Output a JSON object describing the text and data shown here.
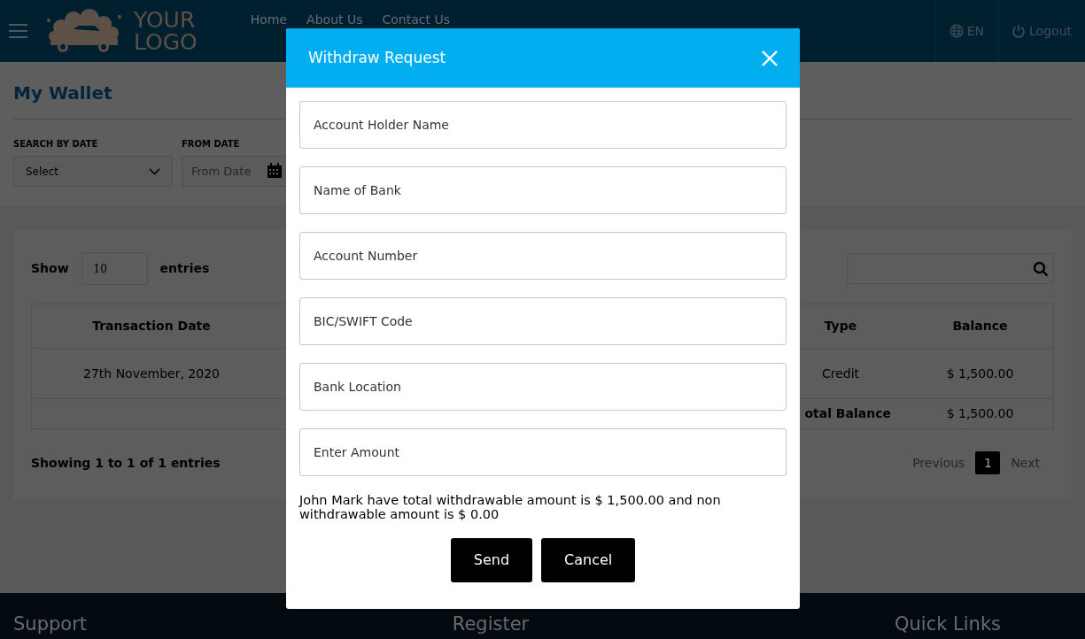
{
  "header": {
    "logo": {
      "line1": "YOUR",
      "line2": "LOGO"
    },
    "nav": [
      "Home",
      "About Us",
      "Contact Us"
    ],
    "language": "EN",
    "logout": "Logout"
  },
  "page_title": "My Wallet",
  "filters": [
    {
      "kind": "select",
      "label": "SEARCH BY DATE",
      "value": "Select"
    },
    {
      "kind": "date",
      "label": "FROM DATE",
      "placeholder": "From Date"
    }
  ],
  "table_controls": {
    "show_label": "Show",
    "page_size": "10",
    "entries_label": "entries"
  },
  "table": {
    "columns": [
      "Transaction Date",
      "Type",
      "Balance"
    ],
    "rows": [
      [
        "27th November, 2020",
        "Credit",
        "$ 1,500.00"
      ]
    ],
    "total": {
      "label": "otal Balance",
      "value": "$ 1,500.00"
    }
  },
  "summary": "Showing 1 to 1 of 1 entries",
  "pagination": {
    "previous": "Previous",
    "pages": [
      {
        "label": "1",
        "selected": true
      }
    ],
    "next": "Next"
  },
  "footer": [
    "Support",
    "Register",
    "Quick Links"
  ],
  "modal": {
    "title": "Withdraw Request",
    "fields": [
      {
        "placeholder": "Account Holder Name"
      },
      {
        "placeholder": "Name of Bank"
      },
      {
        "placeholder": "Account Number"
      },
      {
        "placeholder": "BIC/SWIFT Code"
      },
      {
        "placeholder": "Bank Location"
      },
      {
        "placeholder": "Enter Amount"
      }
    ],
    "message": "John Mark have total withdrawable amount is $ 1,500.00 and non withdrawable amount is $ 0.00",
    "buttons": [
      "Send",
      "Cancel"
    ]
  }
}
